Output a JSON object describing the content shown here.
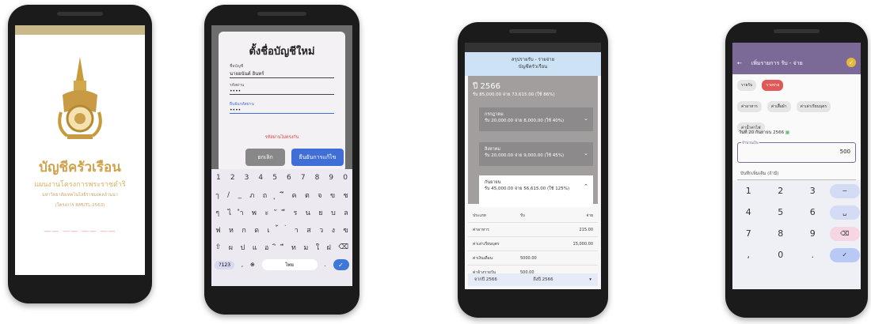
{
  "phone1": {
    "title": "บัญชีครัวเรือน",
    "subtitle": "แผนงานโครงการพระราชดำริ",
    "line1": "มหาวิทยาลัยเทคโนโลยีราชมงคลล้านนา",
    "line2": "(โครงการ RMUTL-2563)",
    "dashes": "—— —— —— ——"
  },
  "phone2": {
    "dialog_title": "ตั้งชื่อบัญชีใหม่",
    "fields": [
      {
        "label": "ชื่อบัญชี",
        "value": "นายอนันต์ อินทร์"
      },
      {
        "label": "รหัสผ่าน",
        "value": "••••"
      },
      {
        "label": "ยืนยันรหัสผ่าน",
        "value": "••••"
      }
    ],
    "warning": "รหัสผ่านไม่ตรงกัน",
    "cancel_label": "ยกเลิก",
    "ok_label": "ยืนยันการแก้ไข",
    "keyboard": {
      "row0": [
        "1",
        "2",
        "3",
        "4",
        "5",
        "6",
        "7",
        "8",
        "9",
        "0"
      ],
      "row1": [
        "ๅ",
        "/",
        "_",
        "ภ",
        "ถ",
        "ุ",
        "ึ",
        "ค",
        "ต",
        "จ",
        "ข",
        "ช"
      ],
      "row2": [
        "ๆ",
        "ไ",
        "ำ",
        "พ",
        "ะ",
        "ั",
        "ี",
        "ร",
        "น",
        "ย",
        "บ",
        "ล"
      ],
      "row3": [
        "ฟ",
        "ห",
        "ก",
        "ด",
        "เ",
        "้",
        "่",
        "า",
        "ส",
        "ว",
        "ง",
        "ฃ"
      ],
      "row4": [
        "⇧",
        "ผ",
        "ป",
        "แ",
        "อ",
        "ิ",
        "ื",
        "ท",
        "ม",
        "ใ",
        "ฝ",
        "⌫"
      ],
      "mode_label": "?123",
      "space_label": "ไทย",
      "enter_icon": "✓"
    }
  },
  "phone3": {
    "header_line1": "สรุปรายรับ - รายจ่าย",
    "header_line2": "บัญชีครัวเรือน",
    "year": "ปี 2566",
    "year_summary": "รับ 85,000.00 จ่าย 73,615.00 (ใช้ 86%)",
    "months": [
      {
        "name": "กรกฎาคม",
        "summary": "รับ 20,000.00 จ่าย 8,000.00 (ใช้ 40%)"
      },
      {
        "name": "สิงหาคม",
        "summary": "รับ 20,000.00 จ่าย 9,000.00 (ใช้ 45%)"
      }
    ],
    "open_month": {
      "name": "กันยายน",
      "summary": "รับ 45,000.00 จ่าย 56,615.00 (ใช้ 125%)"
    },
    "table_header": [
      "ประเภท",
      "รับ",
      "จ่าย"
    ],
    "rows": [
      {
        "type": "ค่าอาหาร",
        "income": "",
        "expense": "215.00"
      },
      {
        "type": "ค่าเล่าเรียนบุตร",
        "income": "",
        "expense": "15,000.00"
      },
      {
        "type": "ค่าเงินเดือน",
        "income": "5000.00",
        "expense": ""
      },
      {
        "type": "ค่าจ้างรายวัน",
        "income": "500.00",
        "expense": ""
      }
    ],
    "footer_from": "จากปี 2566",
    "footer_to": "ถึงปี 2566"
  },
  "phone4": {
    "header_title": "เพิ่มรายการ รับ - จ่าย",
    "chips": [
      "รายรับ",
      "รายจ่าย",
      "ค่าอาหาร",
      "ค่าเสื้อผ้า",
      "ค่าเล่าเรียนบุตร",
      "ค่าน้ำค่าไฟ"
    ],
    "selected_chip": "รายจ่าย",
    "date": "วันที่ 20 กันยายน 2566",
    "amount_label": "จำนวนเงิน",
    "amount": "500",
    "note_placeholder": "บันทึกเพิ่มเติม (ถ้ามี)",
    "numpad": [
      [
        "1",
        "2",
        "3",
        "−"
      ],
      [
        "4",
        "5",
        "6",
        "␣"
      ],
      [
        "7",
        "8",
        "9",
        "⌫"
      ],
      [
        ",",
        "0",
        ".",
        "✓"
      ]
    ]
  }
}
